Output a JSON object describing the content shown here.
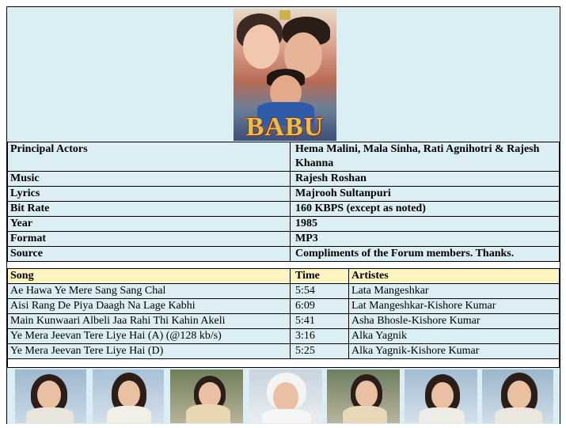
{
  "poster": {
    "title": "BABU"
  },
  "info": [
    {
      "label": "Principal Actors",
      "value": "Hema Malini, Mala Sinha, Rati Agnihotri & Rajesh Khanna"
    },
    {
      "label": "Music",
      "value": "Rajesh Roshan"
    },
    {
      "label": "Lyrics",
      "value": "Majrooh Sultanpuri"
    },
    {
      "label": "Bit Rate",
      "value": "160 KBPS (except as noted)"
    },
    {
      "label": "Year",
      "value": "1985"
    },
    {
      "label": "Format",
      "value": "MP3"
    },
    {
      "label": "Source",
      "value": "Compliments of the Forum members.   Thanks."
    }
  ],
  "songs_header": {
    "song": "Song",
    "time": "Time",
    "artistes": "Artistes"
  },
  "songs": [
    {
      "song": "Ae Hawa Ye Mere Sang Sang Chal",
      "time": "5:54",
      "artistes": "Lata Mangeshkar"
    },
    {
      "song": "Aisi Rang De Piya Daagh Na Lage Kabhi",
      "time": "6:09",
      "artistes": "Lat Mangeshkar-Kishore Kumar"
    },
    {
      "song": "Main Kunwaari Albeli Jaa Rahi Thi Kahin Akeli",
      "time": "5:41",
      "artistes": "Asha Bhosle-Kishore Kumar"
    },
    {
      "song": "Ye Mera Jeevan Tere Liye Hai (A) (@128 kb/s)",
      "time": "3:16",
      "artistes": "Alka Yagnik"
    },
    {
      "song": "Ye Mera Jeevan Tere Liye Hai (D)",
      "time": "5:25",
      "artistes": "Alka Yagnik-Kishore Kumar"
    }
  ],
  "colors": {
    "band": "#dbeef4",
    "header": "#fdf6c2",
    "poster_title": "#e4c24a"
  }
}
